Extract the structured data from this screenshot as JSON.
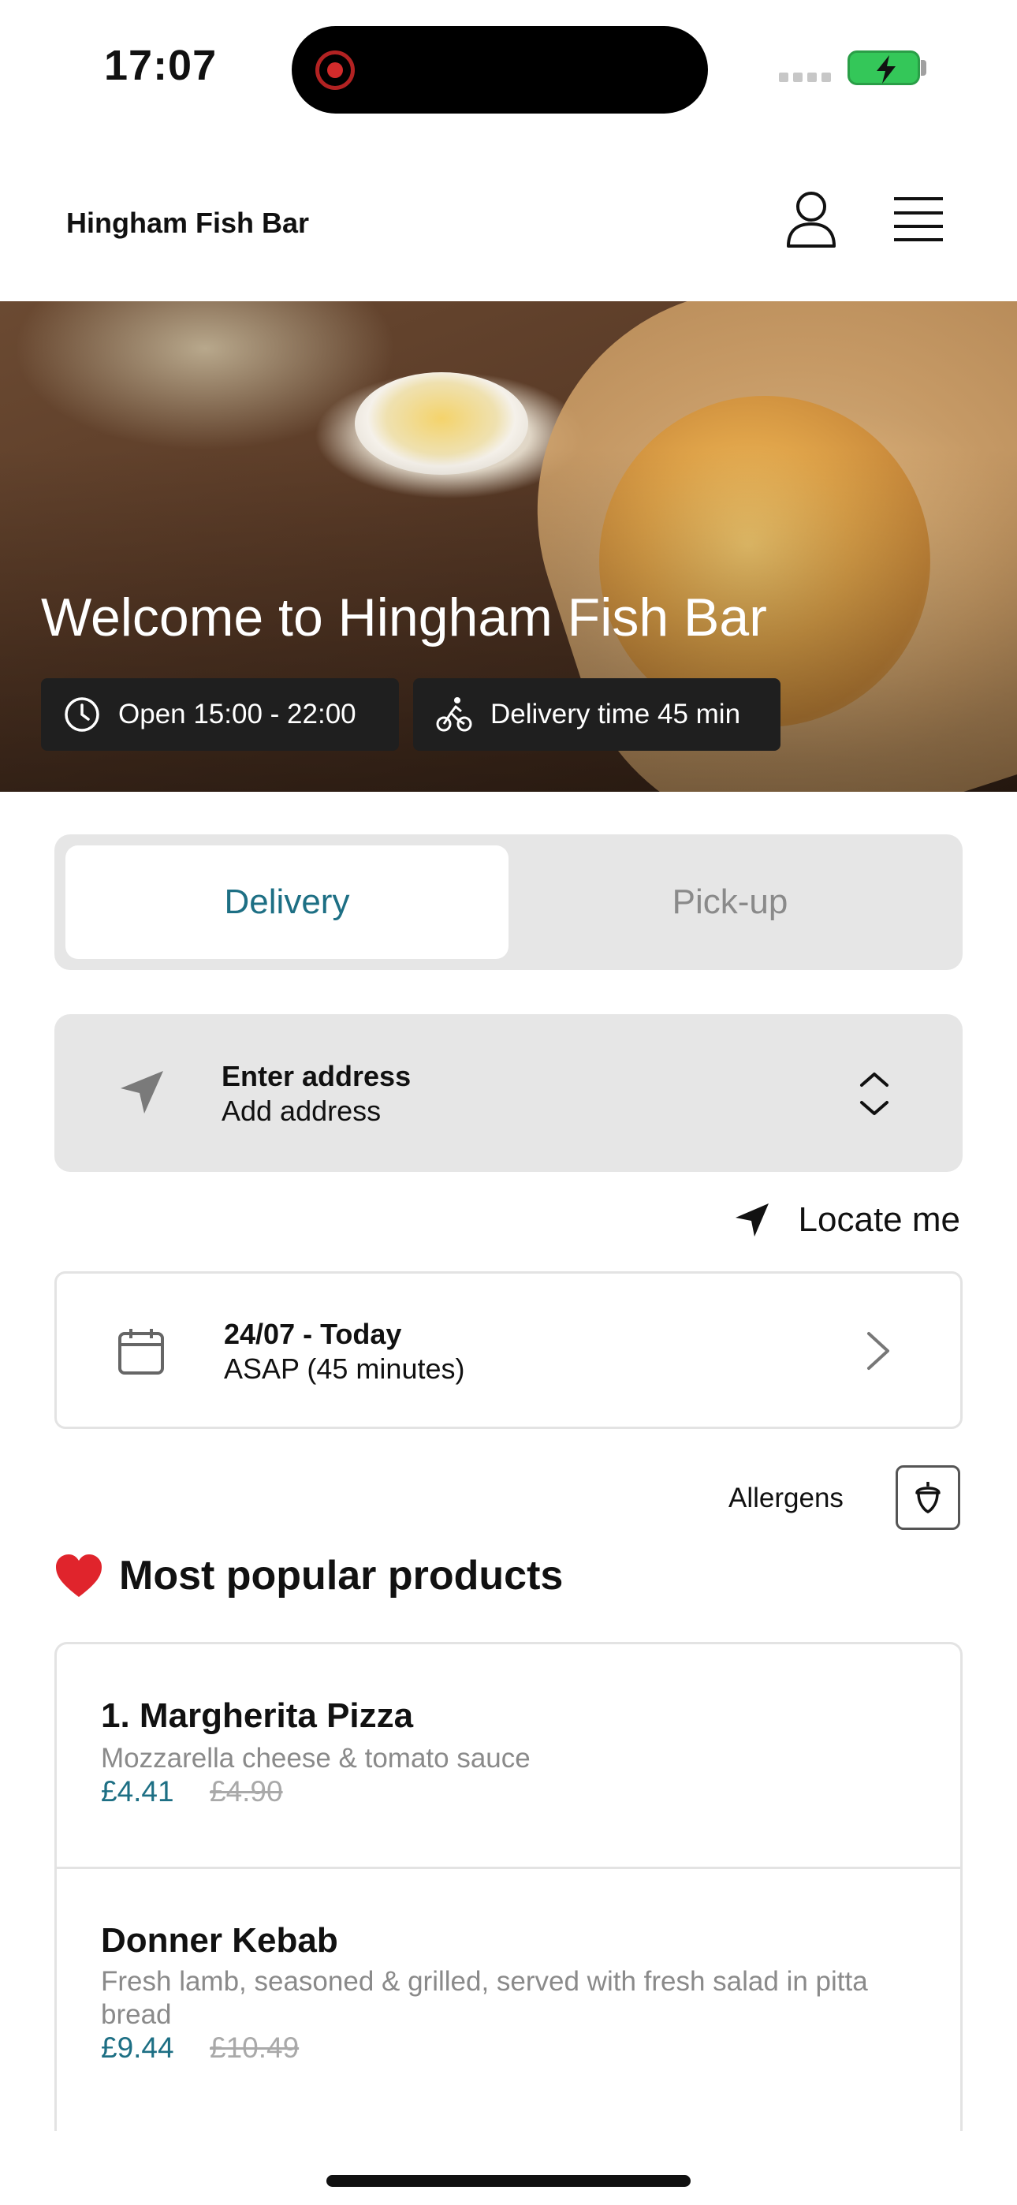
{
  "status_bar": {
    "time": "17:07"
  },
  "header": {
    "brand": "Hingham Fish Bar"
  },
  "hero": {
    "title": "Welcome to Hingham Fish Bar",
    "open_hours": "Open 15:00 - 22:00",
    "delivery_time": "Delivery time 45 min"
  },
  "tabs": [
    {
      "label": "Delivery",
      "selected": true
    },
    {
      "label": "Pick-up",
      "selected": false
    }
  ],
  "address": {
    "title": "Enter address",
    "subtitle": "Add address"
  },
  "locate": {
    "label": "Locate me"
  },
  "schedule": {
    "date": "24/07 - Today",
    "time": "ASAP (45 minutes)"
  },
  "allergens": {
    "label": "Allergens"
  },
  "popular": {
    "title": "Most popular products",
    "products": [
      {
        "name": "1. Margherita Pizza",
        "description": "Mozzarella cheese & tomato sauce",
        "price": "£4.41",
        "old_price": "£4.90"
      },
      {
        "name": "Donner Kebab",
        "description": "Fresh lamb, seasoned & grilled, served with fresh salad in pitta bread",
        "price": "£9.44",
        "old_price": "£10.49"
      }
    ]
  },
  "colors": {
    "accent": "#1d6f84",
    "pill_bg": "#1f1f1f",
    "panel_bg": "#e6e6e6"
  }
}
